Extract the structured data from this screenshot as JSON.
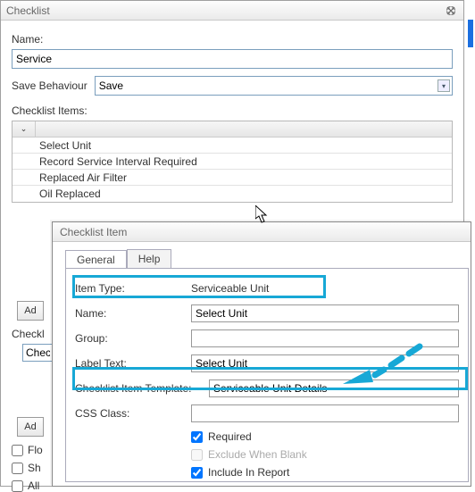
{
  "main_window": {
    "title": "Checklist",
    "name_label": "Name:",
    "name_value": "Service",
    "save_behaviour_label": "Save Behaviour",
    "save_behaviour_value": "Save",
    "checklist_items_label": "Checklist Items:",
    "items": [
      "Select Unit",
      "Record Service Interval Required",
      "Replaced Air Filter",
      "Oil Replaced"
    ],
    "add_button": "Ad",
    "settings_label": "Checkl",
    "settings_value": "Check",
    "cb_float": "Flo",
    "cb_show": "Sh",
    "cb_allow": "All"
  },
  "sub_window": {
    "title": "Checklist Item",
    "tabs": {
      "general": "General",
      "help": "Help"
    },
    "fields": {
      "item_type_label": "Item Type:",
      "item_type_value": "Serviceable Unit",
      "name_label": "Name:",
      "name_value": "Select Unit",
      "group_label": "Group:",
      "group_value": "",
      "label_text_label": "Label Text:",
      "label_text_value": "Select Unit",
      "template_label": "Checklist Item Template:",
      "template_value": "Serviceable Unit Details",
      "css_class_label": "CSS Class:",
      "css_class_value": ""
    },
    "checkboxes": {
      "required": "Required",
      "exclude": "Exclude When Blank",
      "include_report": "Include In Report"
    }
  }
}
